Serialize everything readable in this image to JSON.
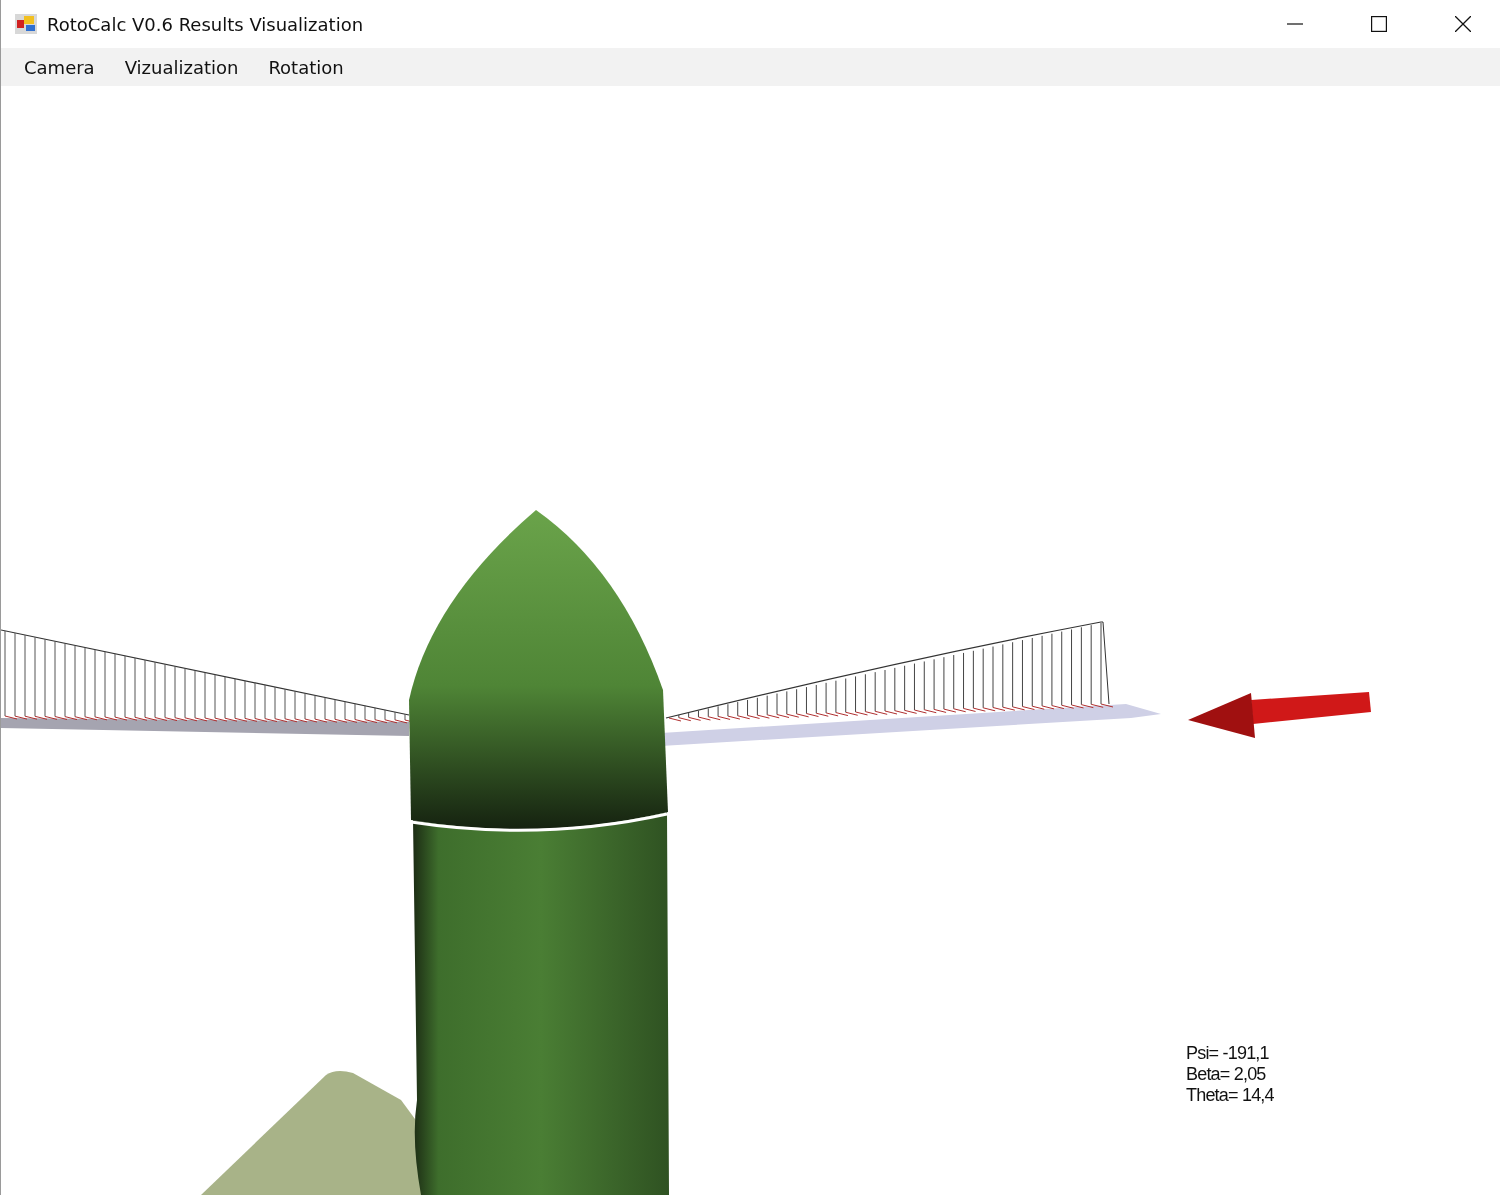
{
  "window": {
    "title": "RotoCalc V0.6 Results Visualization"
  },
  "menu": [
    "Camera",
    "Vizualization",
    "Rotation"
  ],
  "readout": [
    "Psi= -191,1",
    "Beta= 2,05",
    "Theta= 14,4"
  ]
}
